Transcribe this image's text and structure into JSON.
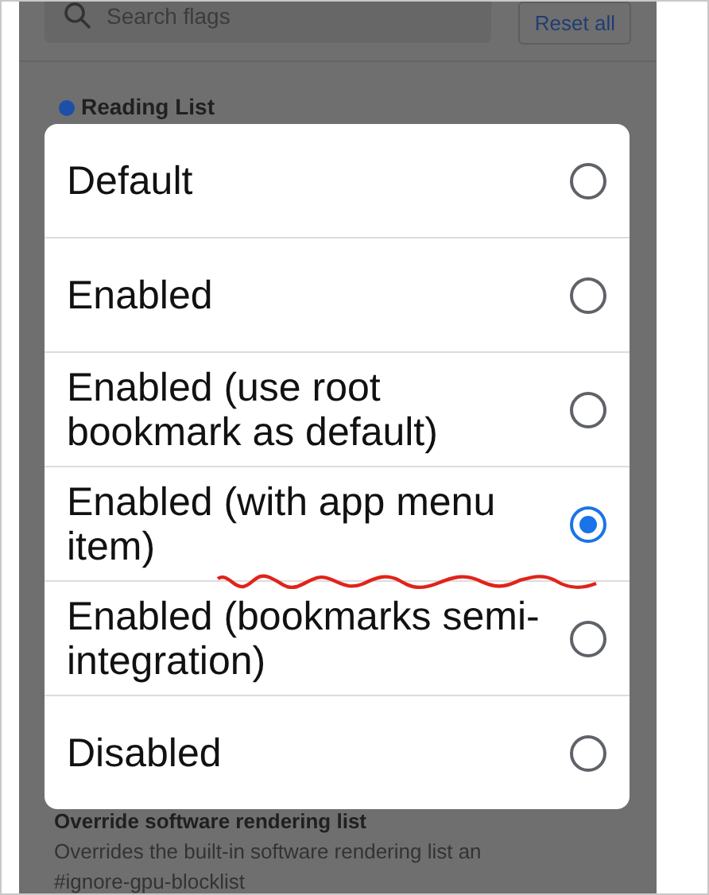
{
  "search": {
    "placeholder": "Search flags"
  },
  "reset_button": "Reset all",
  "flags": [
    {
      "title": "Reading List",
      "modified": true
    },
    {
      "title": "Override software rendering list",
      "description": "Overrides the built-in software rendering list an",
      "anchor": "#ignore-gpu-blocklist",
      "modified": false
    }
  ],
  "dialog": {
    "options": [
      {
        "label": "Default",
        "selected": false
      },
      {
        "label": "Enabled",
        "selected": false
      },
      {
        "label": "Enabled (use root bookmark as default)",
        "selected": false
      },
      {
        "label": "Enabled (with app menu item)",
        "selected": true
      },
      {
        "label": "Enabled (bookmarks semi-integration)",
        "selected": false
      },
      {
        "label": "Disabled",
        "selected": false
      }
    ]
  }
}
